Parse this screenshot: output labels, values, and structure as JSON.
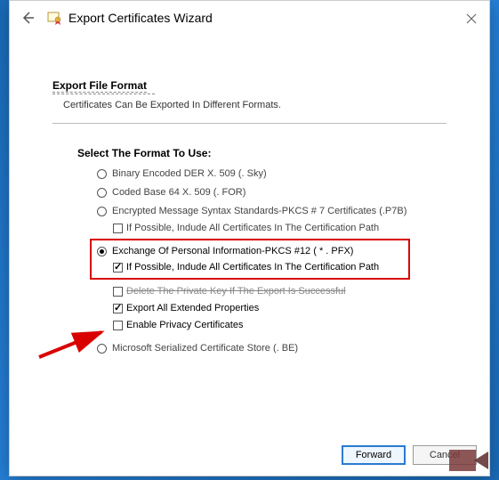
{
  "window": {
    "title": "Export Certificates Wizard"
  },
  "header": {
    "heading": "Export File Format",
    "subheading": "Certificates Can Be Exported In Different Formats."
  },
  "selectLabel": "Select The Format To Use:",
  "options": {
    "der": "Binary Encoded DER X. 509 (. Sky)",
    "base64": "Coded Base 64 X. 509 (. FOR)",
    "pkcs7": "Encrypted Message Syntax Standards-PKCS # 7 Certificates (.P7B)",
    "pkcs7IncludeAll": "If Possible, Indude All Certificates In The Certification Path",
    "pkcs12": "Exchange Of Personal Information-PKCS #12 ( * . PFX)",
    "pkcs12IncludeAll": "If Possible, Indude All Certificates In The Certification Path",
    "deleteKey": "Delete The Private Key If The Export Is Successful",
    "exportExtended": "Export All Extended Properties",
    "enablePrivacy": "Enable Privacy Certificates",
    "msStore": "Microsoft Serialized Certificate Store (. BE)"
  },
  "buttons": {
    "forward": "Forward",
    "cancel": "Cancel"
  }
}
